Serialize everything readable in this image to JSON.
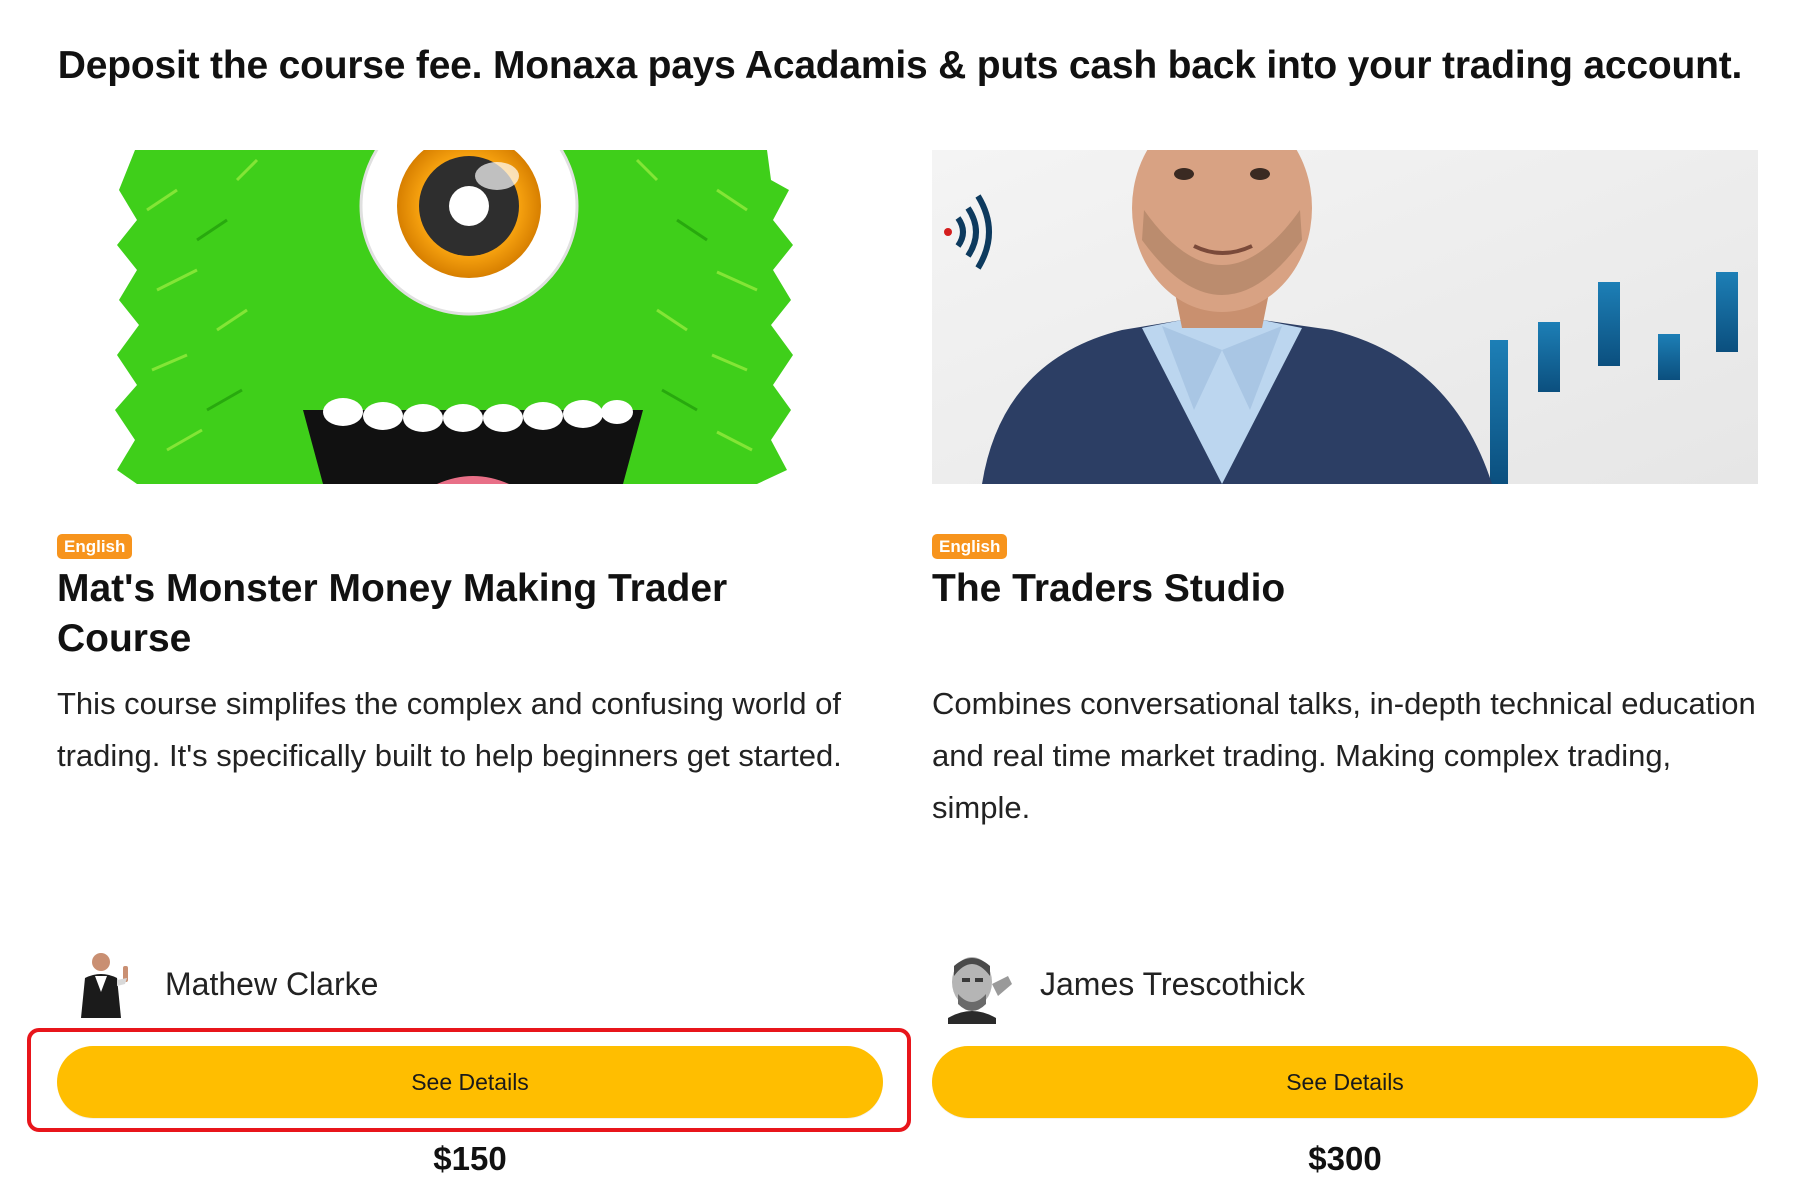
{
  "header": {
    "headline": "Deposit the course fee. Monaxa pays Acadamis & puts cash back into your trading account."
  },
  "courses": [
    {
      "image_icon": "green-monster-icon",
      "language": "English",
      "title": "Mat's Monster Money Making Trader Course",
      "description": "This course simplifes the complex and confusing world of trading. It's specifically built to help beginners get started.",
      "author": "Mathew Clarke",
      "button_label": "See Details",
      "price": "$150"
    },
    {
      "image_icon": "presenter-with-chart-icon",
      "language": "English",
      "title": "The Traders Studio",
      "description": "Combines conversational talks, in-depth technical education and real time market trading. Making complex trading, simple.",
      "author": "James Trescothick",
      "button_label": "See Details",
      "price": "$300"
    }
  ],
  "colors": {
    "button": "#ffbe00",
    "badge": "#f7941d",
    "highlight": "#e8151b"
  }
}
